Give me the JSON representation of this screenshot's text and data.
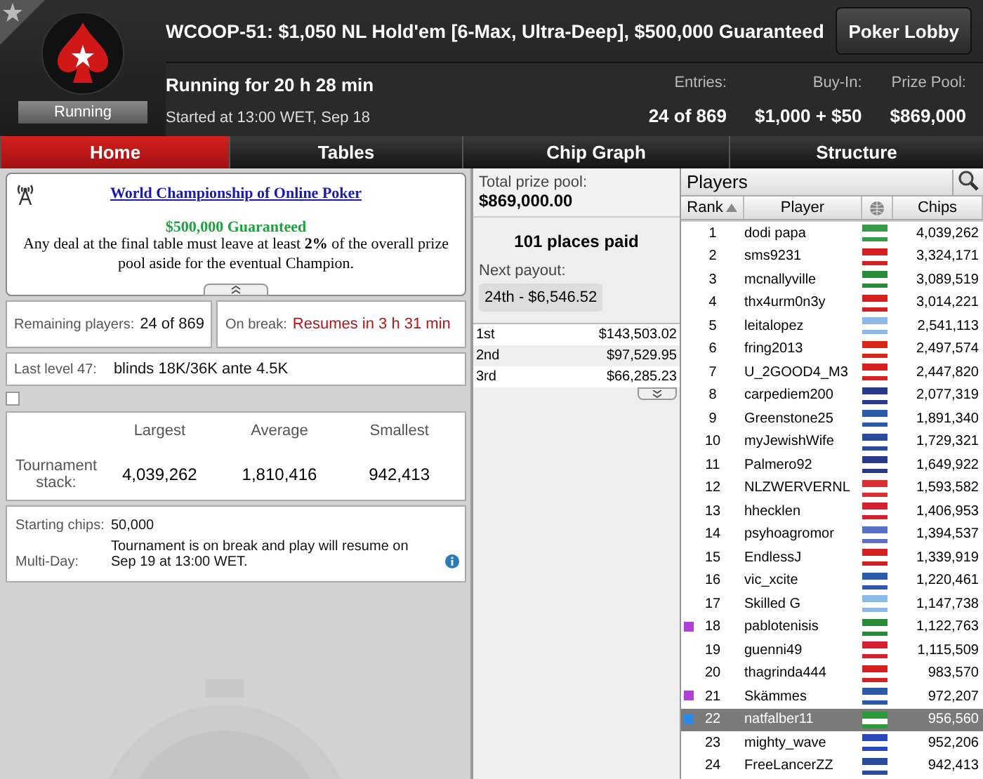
{
  "header": {
    "title": "WCOOP-51: $1,050 NL Hold'em [6-Max, Ultra-Deep], $500,000 Guaranteed",
    "status": "Running",
    "running_for": "Running for 20 h 28 min",
    "started": "Started at 13:00 WET, Sep 18",
    "lobby_button": "Poker Lobby",
    "stats": [
      {
        "label": "Entries:",
        "value": "24 of 869"
      },
      {
        "label": "Buy-In:",
        "value": "$1,000 + $50"
      },
      {
        "label": "Prize Pool:",
        "value": "$869,000"
      }
    ]
  },
  "tabs": [
    {
      "label": "Home",
      "selected": true
    },
    {
      "label": "Tables",
      "selected": false
    },
    {
      "label": "Chip Graph",
      "selected": false
    },
    {
      "label": "Structure",
      "selected": false
    }
  ],
  "announcement": {
    "link": "World Championship of Online Poker",
    "guarantee": "$500,000 Guaranteed",
    "text": "Any deal at the final table must leave at least **2%** of the overall prize pool aside for the eventual Champion."
  },
  "remaining": {
    "label": "Remaining players:",
    "value": "24 of 869"
  },
  "break": {
    "label": "On break:",
    "value": "Resumes in 3 h 31 min"
  },
  "last_level": {
    "label": "Last level 47:",
    "value": "blinds 18K/36K ante 4.5K"
  },
  "checkbox": {
    "checked": false
  },
  "stack": {
    "label": "Tournament stack:",
    "columns": [
      {
        "label": "Largest",
        "value": "4,039,262"
      },
      {
        "label": "Average",
        "value": "1,810,416"
      },
      {
        "label": "Smallest",
        "value": "942,413"
      }
    ]
  },
  "details": [
    {
      "label": "Starting chips:",
      "value": "50,000",
      "kind": "plain"
    },
    {
      "label": "Multi-Day:",
      "value": "Tournament is on break and play will resume on Sep 19 at 13:00 WET.",
      "kind": "note"
    }
  ],
  "prizes": {
    "total_label": "Total prize pool:",
    "total": "$869,000.00",
    "places_paid": "101 places paid",
    "next_label": "Next payout:",
    "next": "24th - $6,546.52",
    "rows": [
      {
        "place": "1st",
        "amount": "$143,503.02"
      },
      {
        "place": "2nd",
        "amount": "$97,529.95"
      },
      {
        "place": "3rd",
        "amount": "$66,285.23"
      }
    ]
  },
  "players": {
    "title": "Players",
    "columns": [
      "Rank",
      "Player",
      "Chips"
    ],
    "rows": [
      {
        "rank": "1",
        "name": "dodi papa",
        "chips": "4,039,262",
        "flag": {
          "color": "#3a9a4a"
        },
        "selected": false
      },
      {
        "rank": "2",
        "name": "sms9231",
        "chips": "3,324,171",
        "flag": {
          "color": "#d42020"
        },
        "selected": false
      },
      {
        "rank": "3",
        "name": "mcnallyville",
        "chips": "3,089,519",
        "flag": {
          "color": "#2a8a3a"
        },
        "selected": false
      },
      {
        "rank": "4",
        "name": "thx4urm0n3y",
        "chips": "3,014,221",
        "flag": {
          "color": "#d42020"
        },
        "selected": false
      },
      {
        "rank": "5",
        "name": "leitalopez",
        "chips": "2,541,113",
        "flag": {
          "color": "#8ab8e8"
        },
        "selected": false
      },
      {
        "rank": "6",
        "name": "fring2013",
        "chips": "2,497,574",
        "flag": {
          "color": "#d82818"
        },
        "selected": false
      },
      {
        "rank": "7",
        "name": "U_2GOOD4_M3",
        "chips": "2,447,820",
        "flag": {
          "color": "#d82020"
        },
        "selected": false
      },
      {
        "rank": "8",
        "name": "carpediem200",
        "chips": "2,077,319",
        "flag": {
          "color": "#2a3a8a"
        },
        "selected": false
      },
      {
        "rank": "9",
        "name": "Greenstone25",
        "chips": "1,891,340",
        "flag": {
          "color": "#2a5aa8"
        },
        "selected": false
      },
      {
        "rank": "10",
        "name": "myJewishWife",
        "chips": "1,729,321",
        "flag": {
          "color": "#2a4a9a"
        },
        "selected": false
      },
      {
        "rank": "11",
        "name": "Palmero92",
        "chips": "1,649,922",
        "flag": {
          "color": "#2a3a8a"
        },
        "selected": false
      },
      {
        "rank": "12",
        "name": "NLZWERVERNL",
        "chips": "1,593,582",
        "flag": {
          "color": "#d83030"
        },
        "selected": false
      },
      {
        "rank": "13",
        "name": "hhecklen",
        "chips": "1,406,953",
        "flag": {
          "color": "#d42030"
        },
        "selected": false
      },
      {
        "rank": "14",
        "name": "psyhoagromor",
        "chips": "1,394,537",
        "flag": {
          "color": "#5a70c8"
        },
        "selected": false
      },
      {
        "rank": "15",
        "name": "EndlessJ",
        "chips": "1,339,919",
        "flag": {
          "color": "#d42020"
        },
        "selected": false
      },
      {
        "rank": "16",
        "name": "vic_xcite",
        "chips": "1,220,461",
        "flag": {
          "color": "#2a5aa8"
        },
        "selected": false
      },
      {
        "rank": "17",
        "name": "Skilled G",
        "chips": "1,147,738",
        "flag": {
          "color": "#8ab8e8"
        },
        "selected": false
      },
      {
        "rank": "18",
        "name": "pablotenisis",
        "chips": "1,122,763",
        "flag": {
          "color": "#2a8a3a"
        },
        "selected": false,
        "color": "#b040d8"
      },
      {
        "rank": "19",
        "name": "guenni49",
        "chips": "1,115,509",
        "flag": {
          "color": "#d42030"
        },
        "selected": false
      },
      {
        "rank": "20",
        "name": "thagrinda444",
        "chips": "983,570",
        "flag": {
          "color": "#d42020"
        },
        "selected": false
      },
      {
        "rank": "21",
        "name": "Skämmes",
        "chips": "972,207",
        "flag": {
          "color": "#2a5aa8"
        },
        "selected": false,
        "color": "#b040d8"
      },
      {
        "rank": "22",
        "name": "natfalber11",
        "chips": "956,560",
        "flag": {
          "color": "#2a9a3a"
        },
        "selected": true,
        "color": "#2a8ae8"
      },
      {
        "rank": "23",
        "name": "mighty_wave",
        "chips": "952,206",
        "flag": {
          "color": "#2a48b8"
        },
        "selected": false
      },
      {
        "rank": "24",
        "name": "FreeLancerZZ",
        "chips": "942,413",
        "flag": {
          "color": "#2a4a9a"
        },
        "selected": false
      }
    ]
  }
}
